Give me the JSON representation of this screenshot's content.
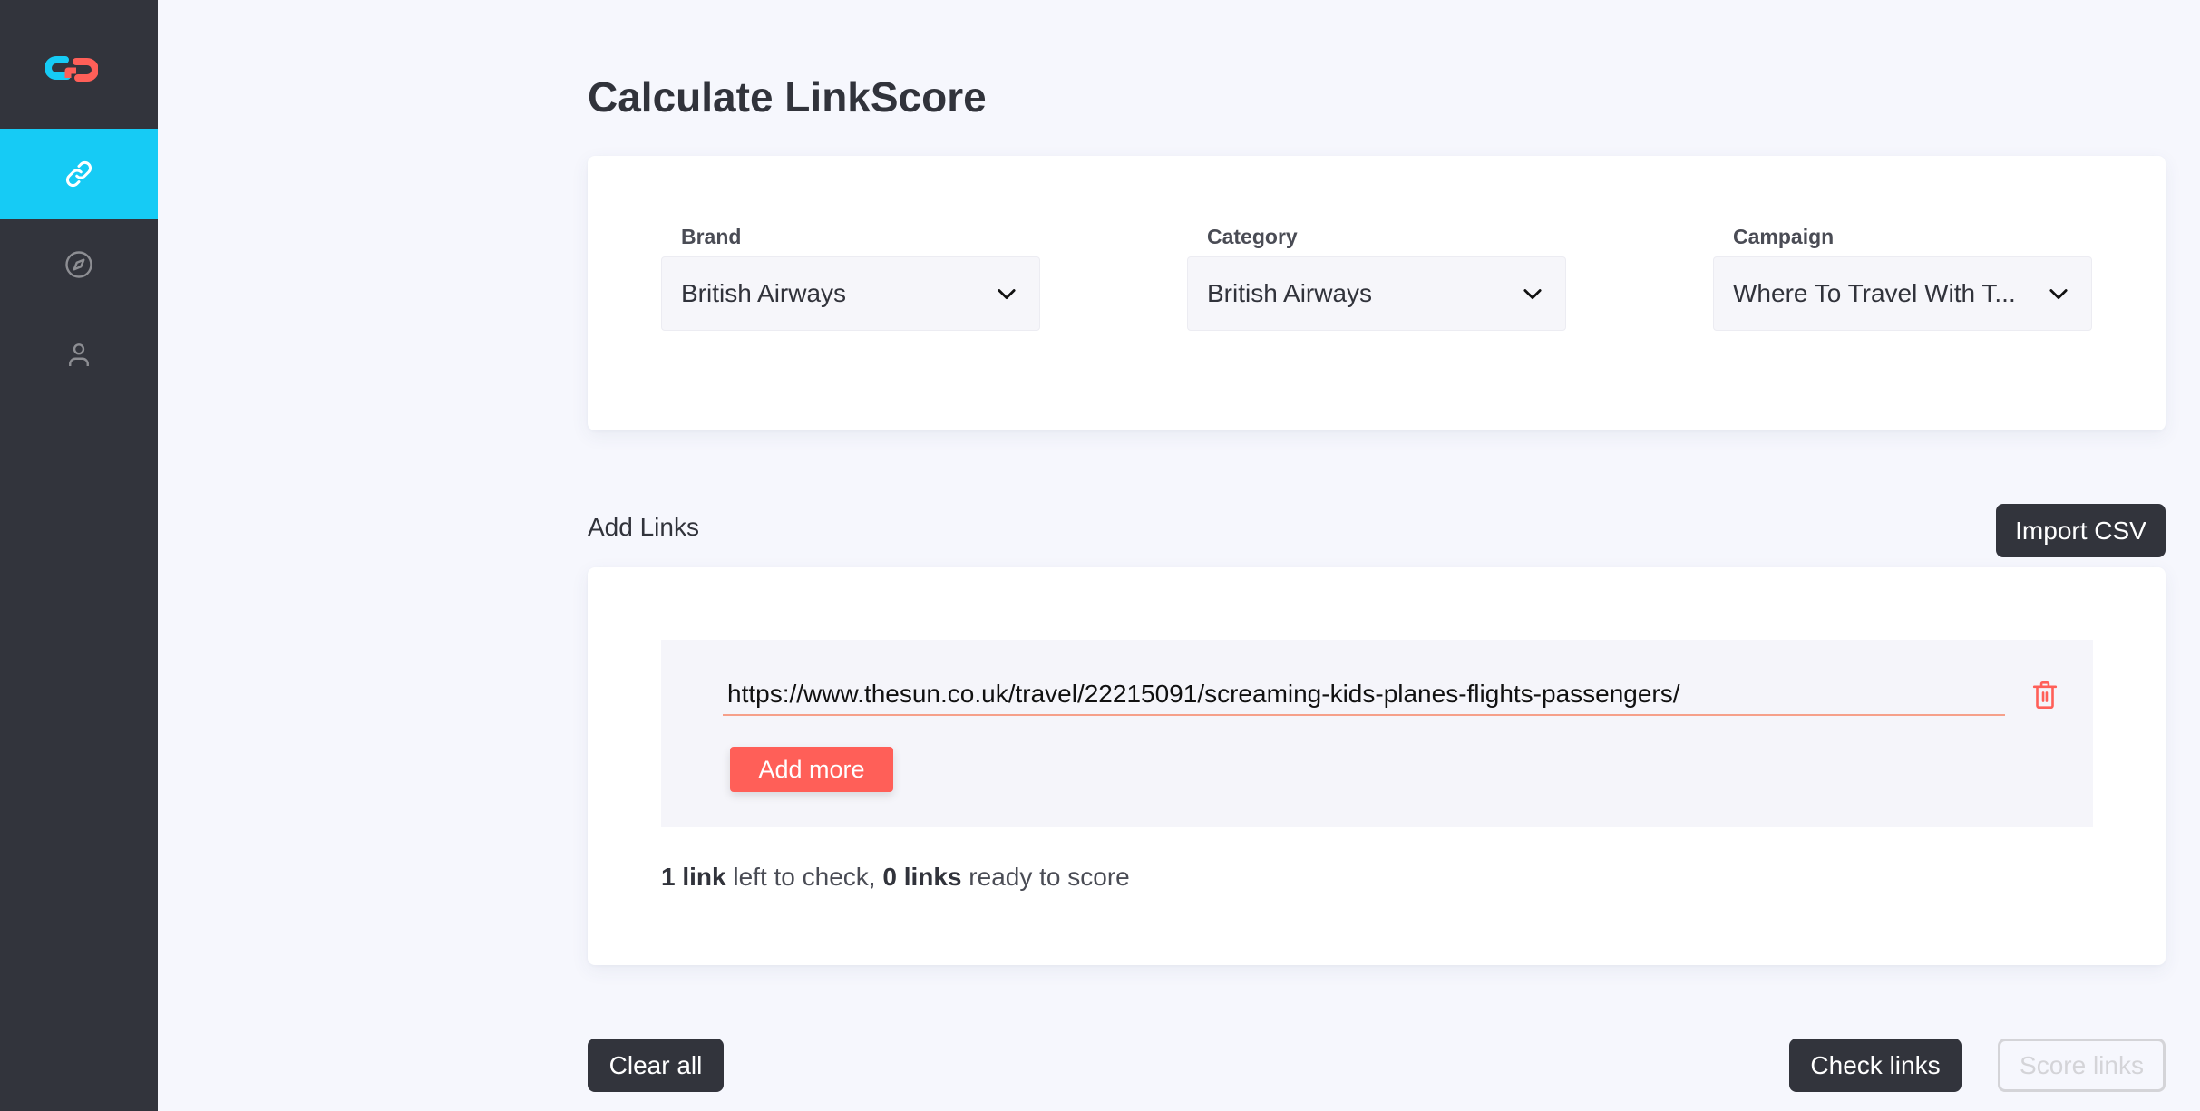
{
  "sidebar": {
    "logo": "linkscore-logo",
    "items": [
      {
        "icon": "link-icon",
        "active": true
      },
      {
        "icon": "compass-icon",
        "active": false
      },
      {
        "icon": "user-icon",
        "active": false
      }
    ],
    "colors": {
      "background": "#32343c",
      "active": "#16cbf5"
    }
  },
  "page": {
    "title": "Calculate LinkScore"
  },
  "filters": {
    "brand": {
      "label": "Brand",
      "value": "British Airways"
    },
    "category": {
      "label": "Category",
      "value": "British Airways"
    },
    "campaign": {
      "label": "Campaign",
      "value": "Where To Travel With T..."
    }
  },
  "links_section": {
    "label": "Add Links",
    "import_button": "Import CSV",
    "links": [
      {
        "url": "https://www.thesun.co.uk/travel/22215091/screaming-kids-planes-flights-passengers/"
      }
    ],
    "add_more_button": "Add more",
    "status": {
      "left_count": "1 link",
      "left_text": " left to check, ",
      "ready_count": "0 links",
      "ready_text": " ready to score"
    },
    "colors": {
      "accent": "#ff5f58",
      "underline": "#f6a08a"
    }
  },
  "footer": {
    "clear_button": "Clear all",
    "check_button": "Check links",
    "score_button": "Score links",
    "score_button_disabled": true
  }
}
